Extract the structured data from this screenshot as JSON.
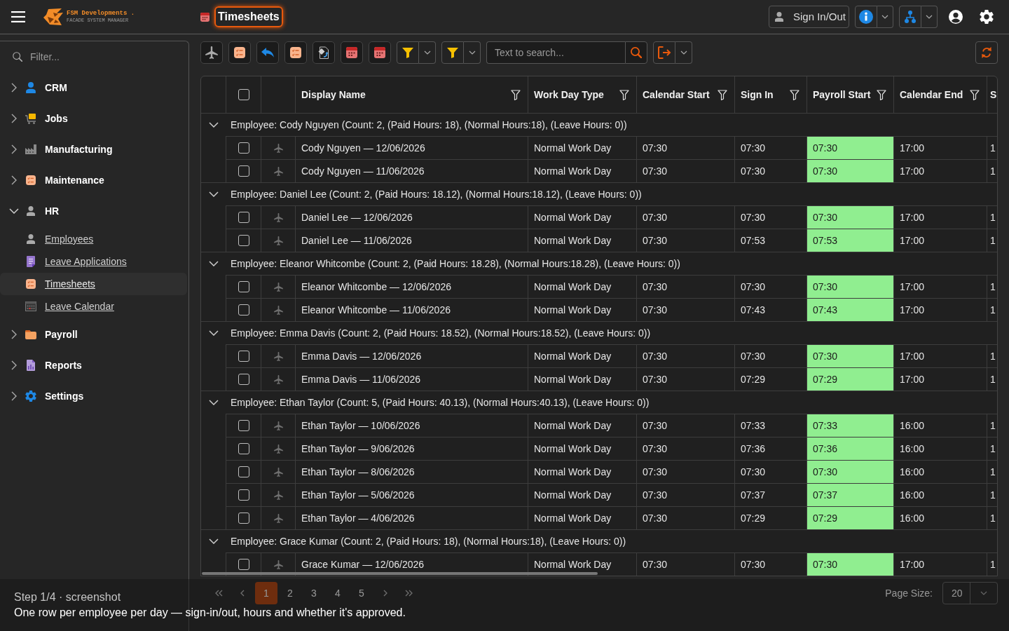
{
  "header": {
    "brand": "FSM Developments .",
    "tagline": "FACADE SYSTEM MANAGER",
    "title": "Timesheets",
    "sign_in_out": "Sign In/Out"
  },
  "sidebar": {
    "filter_placeholder": "Filter...",
    "items": [
      {
        "label": "CRM",
        "expanded": false
      },
      {
        "label": "Jobs",
        "expanded": false
      },
      {
        "label": "Manufacturing",
        "expanded": false
      },
      {
        "label": "Maintenance",
        "expanded": false
      },
      {
        "label": "HR",
        "expanded": true,
        "children": [
          {
            "label": "Employees",
            "selected": false
          },
          {
            "label": "Leave Applications",
            "selected": false
          },
          {
            "label": "Timesheets",
            "selected": true
          },
          {
            "label": "Leave Calendar",
            "selected": false
          }
        ]
      },
      {
        "label": "Payroll",
        "expanded": false
      },
      {
        "label": "Reports",
        "expanded": false
      },
      {
        "label": "Settings",
        "expanded": false
      }
    ]
  },
  "toolbar": {
    "search_placeholder": "Text to search..."
  },
  "table": {
    "header_checkbox": {
      "checked": false
    },
    "columns": [
      {
        "label": "Display Name",
        "kind": "text"
      },
      {
        "label": "Work Day Type",
        "kind": "text"
      },
      {
        "label": "Calendar Start",
        "kind": "text"
      },
      {
        "label": "Sign In",
        "kind": "text"
      },
      {
        "label": "Payroll Start",
        "kind": "highlight"
      },
      {
        "label": "Calendar End",
        "kind": "text"
      },
      {
        "label": "S",
        "kind": "text"
      }
    ],
    "groups": [
      {
        "label": "Employee: Cody Nguyen (Count: 2, (Paid Hours: 18), (Normal Hours:18), (Leave Hours: 0))",
        "expanded": true,
        "rows": [
          {
            "checked": false,
            "cells": [
              "Cody Nguyen — 12/06/2026",
              "Normal Work Day",
              "07:30",
              "07:30",
              "07:30",
              "17:00",
              "1"
            ]
          },
          {
            "checked": false,
            "cells": [
              "Cody Nguyen — 11/06/2026",
              "Normal Work Day",
              "07:30",
              "07:30",
              "07:30",
              "17:00",
              "1"
            ]
          }
        ]
      },
      {
        "label": "Employee: Daniel Lee (Count: 2, (Paid Hours: 18.12), (Normal Hours:18.12), (Leave Hours: 0))",
        "expanded": true,
        "rows": [
          {
            "checked": false,
            "cells": [
              "Daniel Lee — 12/06/2026",
              "Normal Work Day",
              "07:30",
              "07:30",
              "07:30",
              "17:00",
              "1"
            ]
          },
          {
            "checked": false,
            "cells": [
              "Daniel Lee — 11/06/2026",
              "Normal Work Day",
              "07:30",
              "07:53",
              "07:53",
              "17:00",
              "1"
            ]
          }
        ]
      },
      {
        "label": "Employee: Eleanor Whitcombe (Count: 2, (Paid Hours: 18.28), (Normal Hours:18.28), (Leave Hours: 0))",
        "expanded": true,
        "rows": [
          {
            "checked": false,
            "cells": [
              "Eleanor Whitcombe — 12/06/2026",
              "Normal Work Day",
              "07:30",
              "07:30",
              "07:30",
              "17:00",
              "1"
            ]
          },
          {
            "checked": false,
            "cells": [
              "Eleanor Whitcombe — 11/06/2026",
              "Normal Work Day",
              "07:30",
              "07:43",
              "07:43",
              "17:00",
              "1"
            ]
          }
        ]
      },
      {
        "label": "Employee: Emma Davis (Count: 2, (Paid Hours: 18.52), (Normal Hours:18.52), (Leave Hours: 0))",
        "expanded": true,
        "rows": [
          {
            "checked": false,
            "cells": [
              "Emma Davis — 12/06/2026",
              "Normal Work Day",
              "07:30",
              "07:30",
              "07:30",
              "17:00",
              "1"
            ]
          },
          {
            "checked": false,
            "cells": [
              "Emma Davis — 11/06/2026",
              "Normal Work Day",
              "07:30",
              "07:29",
              "07:29",
              "17:00",
              "1"
            ]
          }
        ]
      },
      {
        "label": "Employee: Ethan Taylor (Count: 5, (Paid Hours: 40.13), (Normal Hours:40.13), (Leave Hours: 0))",
        "expanded": true,
        "rows": [
          {
            "checked": false,
            "cells": [
              "Ethan Taylor — 10/06/2026",
              "Normal Work Day",
              "07:30",
              "07:33",
              "07:33",
              "16:00",
              "1"
            ]
          },
          {
            "checked": false,
            "cells": [
              "Ethan Taylor — 9/06/2026",
              "Normal Work Day",
              "07:30",
              "07:36",
              "07:36",
              "16:00",
              "1"
            ]
          },
          {
            "checked": false,
            "cells": [
              "Ethan Taylor — 8/06/2026",
              "Normal Work Day",
              "07:30",
              "07:30",
              "07:30",
              "16:00",
              "1"
            ]
          },
          {
            "checked": false,
            "cells": [
              "Ethan Taylor — 5/06/2026",
              "Normal Work Day",
              "07:30",
              "07:37",
              "07:37",
              "16:00",
              "1"
            ]
          },
          {
            "checked": false,
            "cells": [
              "Ethan Taylor — 4/06/2026",
              "Normal Work Day",
              "07:30",
              "07:29",
              "07:29",
              "16:00",
              "1"
            ]
          }
        ]
      },
      {
        "label": "Employee: Grace Kumar (Count: 2, (Paid Hours: 18), (Normal Hours:18), (Leave Hours: 0))",
        "expanded": true,
        "rows": [
          {
            "checked": false,
            "cells": [
              "Grace Kumar — 12/06/2026",
              "Normal Work Day",
              "07:30",
              "07:30",
              "07:30",
              "17:00",
              "1"
            ]
          }
        ]
      }
    ]
  },
  "pager": {
    "pages": [
      {
        "label": "1",
        "selected": true
      },
      {
        "label": "2",
        "selected": false
      },
      {
        "label": "3",
        "selected": false
      },
      {
        "label": "4",
        "selected": false
      },
      {
        "label": "5",
        "selected": false
      }
    ],
    "page_size_label": "Page Size:",
    "page_size": "20"
  },
  "tour": {
    "step": "Step 1/4 · screenshot",
    "caption": "One row per employee per day — sign-in/out, hours and whether it's approved."
  }
}
